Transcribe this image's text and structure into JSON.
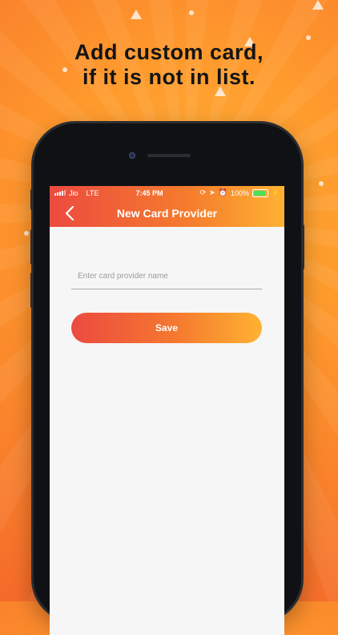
{
  "promo": {
    "line1": "Add custom card,",
    "line2": "if it is not in list."
  },
  "status_bar": {
    "carrier": "Jio",
    "network": "LTE",
    "time": "7:45 PM",
    "battery": "100%"
  },
  "header": {
    "title": "New Card Provider",
    "back_icon": "chevron-left-icon"
  },
  "form": {
    "provider_name_placeholder": "Enter card provider name",
    "save_label": "Save"
  },
  "colors": {
    "accent_start": "#ec4a3f",
    "accent_end": "#ffb233"
  }
}
